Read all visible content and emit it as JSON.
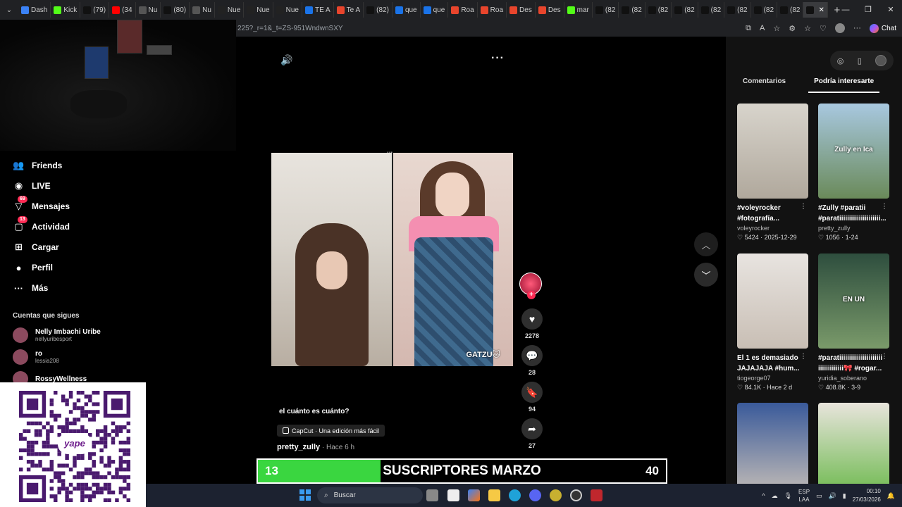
{
  "browser": {
    "tabs": [
      {
        "label": "Dash",
        "color": "#3b82f6",
        "active": false
      },
      {
        "label": "Kick",
        "color": "#53fc18",
        "active": false
      },
      {
        "label": "(79)",
        "color": "#111111",
        "active": false
      },
      {
        "label": "(34",
        "color": "#ff0000",
        "active": false
      },
      {
        "label": "Nu",
        "color": "#555555",
        "active": false
      },
      {
        "label": "(80)",
        "color": "#111111",
        "active": false
      },
      {
        "label": "Nu",
        "color": "#555555",
        "active": false
      },
      {
        "label": "Nue",
        "color": "#222222",
        "active": false
      },
      {
        "label": "Nue",
        "color": "#222222",
        "active": false
      },
      {
        "label": "Nue",
        "color": "#222222",
        "active": false
      },
      {
        "label": "TE A",
        "color": "#1a73e8",
        "active": false
      },
      {
        "label": "Te A",
        "color": "#e8452c",
        "active": false
      },
      {
        "label": "(82)",
        "color": "#111111",
        "active": false
      },
      {
        "label": "que",
        "color": "#1a73e8",
        "active": false
      },
      {
        "label": "que",
        "color": "#1a73e8",
        "active": false
      },
      {
        "label": "Roa",
        "color": "#e8452c",
        "active": false
      },
      {
        "label": "Roa",
        "color": "#e8452c",
        "active": false
      },
      {
        "label": "Des",
        "color": "#e8452c",
        "active": false
      },
      {
        "label": "Des",
        "color": "#e8452c",
        "active": false
      },
      {
        "label": "mar",
        "color": "#53fc18",
        "active": false
      },
      {
        "label": "(82",
        "color": "#111111",
        "active": false
      },
      {
        "label": "(82",
        "color": "#111111",
        "active": false
      },
      {
        "label": "(82",
        "color": "#111111",
        "active": false
      },
      {
        "label": "(82",
        "color": "#111111",
        "active": false
      },
      {
        "label": "(82",
        "color": "#111111",
        "active": false
      },
      {
        "label": "(82",
        "color": "#111111",
        "active": false
      },
      {
        "label": "(82",
        "color": "#111111",
        "active": false
      },
      {
        "label": "(82",
        "color": "#111111",
        "active": false
      },
      {
        "label": "",
        "color": "#111111",
        "active": true
      }
    ],
    "url": "225?_r=1&_t=ZS-951WndwnSXY",
    "chat_label": "Chat"
  },
  "sidebar": {
    "nav": [
      {
        "icon": "friends-icon",
        "glyph": "👥",
        "label": "Friends",
        "badge": ""
      },
      {
        "icon": "live-icon",
        "glyph": "◉",
        "label": "LIVE",
        "badge": ""
      },
      {
        "icon": "messages-icon",
        "glyph": "▽",
        "label": "Mensajes",
        "badge": "69"
      },
      {
        "icon": "activity-icon",
        "glyph": "▢",
        "label": "Actividad",
        "badge": "13"
      },
      {
        "icon": "upload-icon",
        "glyph": "⊞",
        "label": "Cargar",
        "badge": ""
      },
      {
        "icon": "profile-icon",
        "glyph": "●",
        "label": "Perfil",
        "badge": ""
      },
      {
        "icon": "more-icon",
        "glyph": "···",
        "label": "Más",
        "badge": ""
      }
    ],
    "following_title": "Cuentas que sigues",
    "following": [
      {
        "name": "Nelly Imbachi Uribe",
        "handle": "nellyuribesport"
      },
      {
        "name": "ro",
        "handle": "lessia208"
      },
      {
        "name": "RossyWellness",
        "handle": ""
      }
    ]
  },
  "qr": {
    "label": "yape"
  },
  "video": {
    "overlay_text": "GATZU🐱",
    "caption": "el cuánto es cuánto?",
    "capcut": "CapCut · Una edición más fácil",
    "author": "pretty_zully",
    "posted": " · Hace 6 h",
    "likes": "2278",
    "comments": "28",
    "saves": "94",
    "shares": "27"
  },
  "subs_banner": {
    "title": "SUSCRIPTORES MARZO",
    "current": "13",
    "goal": "40",
    "progress": 0.3,
    "color": "#3ad640"
  },
  "right_panel": {
    "tab_comments": "Comentarios",
    "tab_suggested": "Podría interesarte",
    "cards": [
      {
        "thumb_text": "",
        "title": "#voleyrocker #fotografía...",
        "user": "voleyrocker",
        "stats": "♡ 5424 · 2025-12-29",
        "color1": "#d8d4cc",
        "color2": "#b0a89c"
      },
      {
        "thumb_text": "Zully en Ica",
        "title": "#Zully #paratii #parati⁣iiiiiiiiiiiiiiiiiiii...",
        "user": "pretty_zully",
        "stats": "♡ 1056 · 1-24",
        "color1": "#a8c8e0",
        "color2": "#6a8a5a"
      },
      {
        "thumb_text": "",
        "title": "El 1 es demasiado JAJAJAJA #hum...",
        "user": "tiogeorge07",
        "stats": "♡ 84.1K · Hace 2 d",
        "color1": "#e8e4e0",
        "color2": "#c8beb4"
      },
      {
        "thumb_text": "EN UN",
        "title": "#parati⁣iiiiiiiiiiiiiiiiiiiii iiiiiiiiiiiii🎀 #rogar...",
        "user": "yuridia_soberano",
        "stats": "♡ 408.8K · 3-9",
        "color1": "#2e4e3e",
        "color2": "#7a9a6a"
      },
      {
        "thumb_text": "",
        "title": "",
        "user": "",
        "stats": "",
        "color1": "#3a5a9a",
        "color2": "#c8c0b8"
      },
      {
        "thumb_text": "",
        "title": "",
        "user": "",
        "stats": "",
        "color1": "#e8e4dc",
        "color2": "#6ab84a"
      }
    ]
  },
  "taskbar": {
    "search_placeholder": "Buscar",
    "lang_top": "ESP",
    "lang_bottom": "LAA",
    "time": "00:10",
    "date": "27/03/2026"
  }
}
